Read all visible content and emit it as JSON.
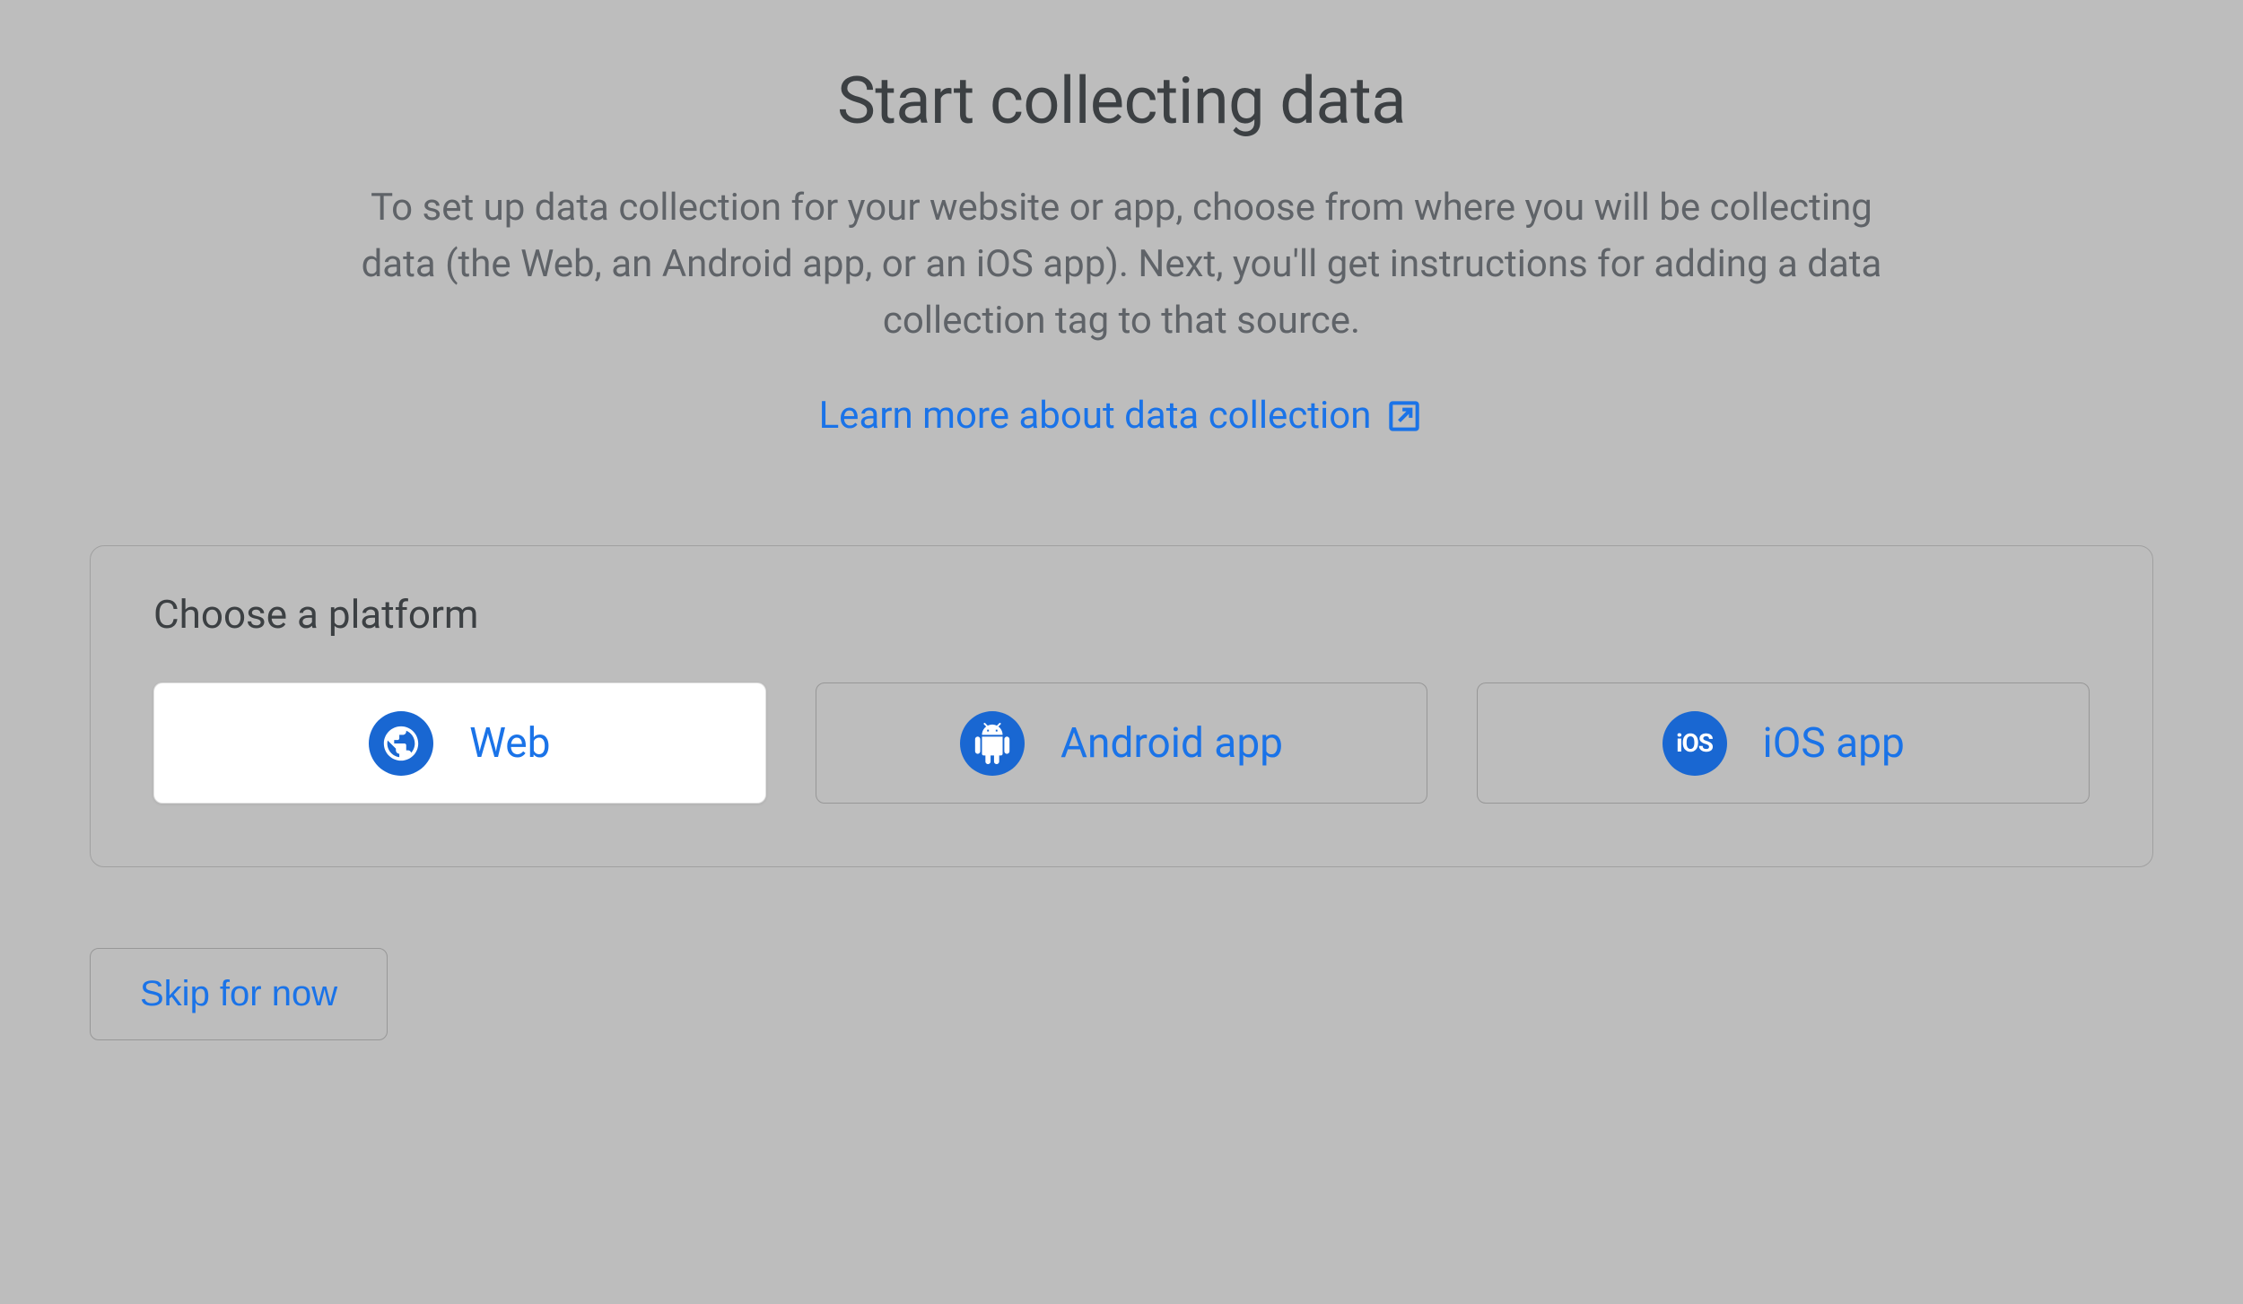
{
  "header": {
    "title": "Start collecting data",
    "description": "To set up data collection for your website or app, choose from where you will be collecting data (the Web, an Android app, or an iOS app). Next, you'll get instructions for adding a data collection tag to that source.",
    "learn_more_label": "Learn more about data collection"
  },
  "platform": {
    "section_label": "Choose a platform",
    "options": [
      {
        "label": "Web",
        "selected": true
      },
      {
        "label": "Android app",
        "selected": false
      },
      {
        "label": "iOS app",
        "selected": false
      }
    ],
    "ios_icon_text": "iOS"
  },
  "footer": {
    "skip_label": "Skip for now"
  },
  "colors": {
    "link": "#1a73e8",
    "icon_bg": "#1967d2",
    "page_bg": "#bdbdbd",
    "text_primary": "#3c4043",
    "text_secondary": "#5f6368"
  }
}
